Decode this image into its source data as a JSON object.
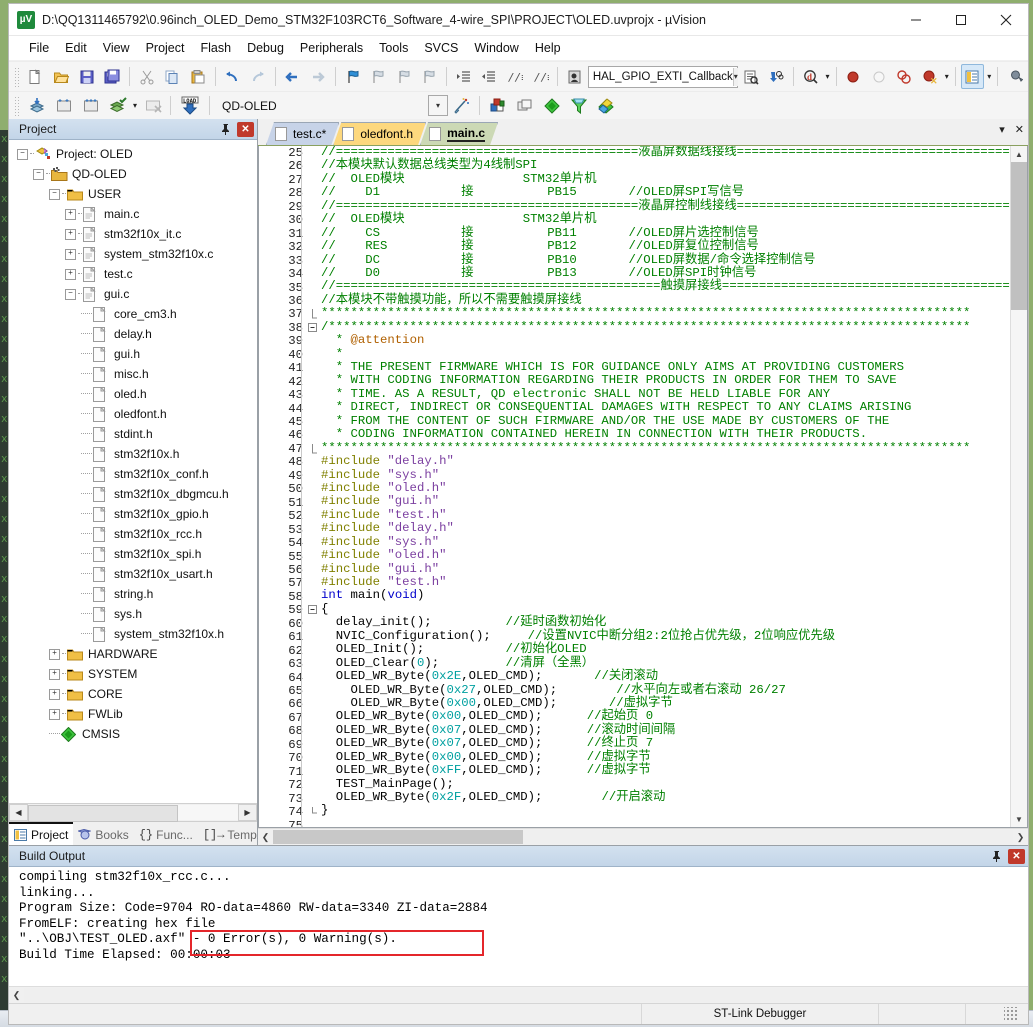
{
  "window": {
    "title": "D:\\QQ1311465792\\0.96inch_OLED_Demo_STM32F103RCT6_Software_4-wire_SPI\\PROJECT\\OLED.uvprojx - µVision",
    "app_icon": "uvision-icon",
    "minimize": "—",
    "maximize": "▢",
    "close": "✕"
  },
  "menubar": {
    "items": [
      "File",
      "Edit",
      "View",
      "Project",
      "Flash",
      "Debug",
      "Peripherals",
      "Tools",
      "SVCS",
      "Window",
      "Help"
    ]
  },
  "toolbar1": {
    "function_combo_value": "HAL_GPIO_EXTI_Callback"
  },
  "toolbar2": {
    "target_combo_value": "QD-OLED",
    "load_label": "LOAD"
  },
  "project_panel": {
    "title": "Project",
    "pin": "📌",
    "close": "✕",
    "tree": [
      {
        "label": "Project: OLED",
        "depth": 0,
        "expander": "minus",
        "icon": "project-icon"
      },
      {
        "label": "QD-OLED",
        "depth": 1,
        "expander": "minus",
        "icon": "target-icon"
      },
      {
        "label": "USER",
        "depth": 2,
        "expander": "minus",
        "icon": "folder-icon"
      },
      {
        "label": "main.c",
        "depth": 3,
        "expander": "plus",
        "icon": "c-file-icon"
      },
      {
        "label": "stm32f10x_it.c",
        "depth": 3,
        "expander": "plus",
        "icon": "c-file-icon"
      },
      {
        "label": "system_stm32f10x.c",
        "depth": 3,
        "expander": "plus",
        "icon": "c-file-icon"
      },
      {
        "label": "test.c",
        "depth": 3,
        "expander": "plus",
        "icon": "c-file-icon"
      },
      {
        "label": "gui.c",
        "depth": 3,
        "expander": "minus",
        "icon": "c-file-icon"
      },
      {
        "label": "core_cm3.h",
        "depth": 4,
        "expander": "none",
        "icon": "h-file-icon"
      },
      {
        "label": "delay.h",
        "depth": 4,
        "expander": "none",
        "icon": "h-file-icon"
      },
      {
        "label": "gui.h",
        "depth": 4,
        "expander": "none",
        "icon": "h-file-icon"
      },
      {
        "label": "misc.h",
        "depth": 4,
        "expander": "none",
        "icon": "h-file-icon"
      },
      {
        "label": "oled.h",
        "depth": 4,
        "expander": "none",
        "icon": "h-file-icon"
      },
      {
        "label": "oledfont.h",
        "depth": 4,
        "expander": "none",
        "icon": "h-file-icon"
      },
      {
        "label": "stdint.h",
        "depth": 4,
        "expander": "none",
        "icon": "h-file-icon"
      },
      {
        "label": "stm32f10x.h",
        "depth": 4,
        "expander": "none",
        "icon": "h-file-icon"
      },
      {
        "label": "stm32f10x_conf.h",
        "depth": 4,
        "expander": "none",
        "icon": "h-file-icon"
      },
      {
        "label": "stm32f10x_dbgmcu.h",
        "depth": 4,
        "expander": "none",
        "icon": "h-file-icon"
      },
      {
        "label": "stm32f10x_gpio.h",
        "depth": 4,
        "expander": "none",
        "icon": "h-file-icon"
      },
      {
        "label": "stm32f10x_rcc.h",
        "depth": 4,
        "expander": "none",
        "icon": "h-file-icon"
      },
      {
        "label": "stm32f10x_spi.h",
        "depth": 4,
        "expander": "none",
        "icon": "h-file-icon"
      },
      {
        "label": "stm32f10x_usart.h",
        "depth": 4,
        "expander": "none",
        "icon": "h-file-icon"
      },
      {
        "label": "string.h",
        "depth": 4,
        "expander": "none",
        "icon": "h-file-icon"
      },
      {
        "label": "sys.h",
        "depth": 4,
        "expander": "none",
        "icon": "h-file-icon"
      },
      {
        "label": "system_stm32f10x.h",
        "depth": 4,
        "expander": "none",
        "icon": "h-file-icon"
      },
      {
        "label": "HARDWARE",
        "depth": 2,
        "expander": "plus",
        "icon": "folder-icon"
      },
      {
        "label": "SYSTEM",
        "depth": 2,
        "expander": "plus",
        "icon": "folder-icon"
      },
      {
        "label": "CORE",
        "depth": 2,
        "expander": "plus",
        "icon": "folder-icon"
      },
      {
        "label": "FWLib",
        "depth": 2,
        "expander": "plus",
        "icon": "folder-icon"
      },
      {
        "label": "CMSIS",
        "depth": 2,
        "expander": "none",
        "icon": "cmsis-diamond-icon"
      }
    ],
    "bottom_tabs": [
      {
        "label": "Project",
        "selected": true,
        "icon": "project-tab-icon"
      },
      {
        "label": "Books",
        "selected": false,
        "icon": "books-icon"
      },
      {
        "label": "Func...",
        "selected": false,
        "icon": "functions-icon"
      },
      {
        "label": "Temp...",
        "selected": false,
        "icon": "templates-icon"
      }
    ]
  },
  "editor": {
    "tabs": [
      {
        "label": "test.c*",
        "style": "blue",
        "active": false
      },
      {
        "label": "oledfont.h",
        "style": "orange",
        "active": false
      },
      {
        "label": "main.c",
        "style": "green",
        "active": true
      }
    ],
    "tab_dropdown": "▾",
    "tab_close": "✕",
    "first_line_number": 25,
    "lines": [
      {
        "n": 25,
        "fold": "",
        "segs": [
          {
            "t": "//=========================================液晶屏数据线接线=========================================",
            "c": "cmt"
          }
        ]
      },
      {
        "n": 26,
        "fold": "",
        "segs": [
          {
            "t": "//本模块默认数据总线类型为4线制SPI",
            "c": "cmt"
          }
        ]
      },
      {
        "n": 27,
        "fold": "",
        "segs": [
          {
            "t": "//  OLED模块                STM32单片机",
            "c": "cmt"
          }
        ]
      },
      {
        "n": 28,
        "fold": "",
        "segs": [
          {
            "t": "//    D1           接          PB15       //OLED屏SPI写信号",
            "c": "cmt"
          }
        ]
      },
      {
        "n": 29,
        "fold": "",
        "segs": [
          {
            "t": "//=========================================液晶屏控制线接线=========================================",
            "c": "cmt"
          }
        ]
      },
      {
        "n": 30,
        "fold": "",
        "segs": [
          {
            "t": "//  OLED模块                STM32单片机",
            "c": "cmt"
          }
        ]
      },
      {
        "n": 31,
        "fold": "",
        "segs": [
          {
            "t": "//    CS           接          PB11       //OLED屏片选控制信号",
            "c": "cmt"
          }
        ]
      },
      {
        "n": 32,
        "fold": "",
        "segs": [
          {
            "t": "//    RES          接          PB12       //OLED屏复位控制信号",
            "c": "cmt"
          }
        ]
      },
      {
        "n": 33,
        "fold": "",
        "segs": [
          {
            "t": "//    DC           接          PB10       //OLED屏数据/命令选择控制信号",
            "c": "cmt"
          }
        ]
      },
      {
        "n": 34,
        "fold": "",
        "segs": [
          {
            "t": "//    D0           接          PB13       //OLED屏SPI时钟信号",
            "c": "cmt"
          }
        ]
      },
      {
        "n": 35,
        "fold": "",
        "segs": [
          {
            "t": "//============================================触摸屏接线============================================//",
            "c": "cmt"
          }
        ]
      },
      {
        "n": 36,
        "fold": "",
        "segs": [
          {
            "t": "//本模块不带触摸功能，所以不需要触摸屏接线",
            "c": "cmt"
          }
        ]
      },
      {
        "n": 37,
        "fold": "end",
        "segs": [
          {
            "t": "****************************************************************************************",
            "c": "cmt"
          }
        ]
      },
      {
        "n": 38,
        "fold": "start",
        "segs": [
          {
            "t": "/***************************************************************************************",
            "c": "cmt"
          }
        ]
      },
      {
        "n": 39,
        "fold": "",
        "segs": [
          {
            "t": "  * ",
            "c": "cmt"
          },
          {
            "t": "@attention",
            "c": "attn"
          }
        ]
      },
      {
        "n": 40,
        "fold": "",
        "segs": [
          {
            "t": "  *",
            "c": "cmt"
          }
        ]
      },
      {
        "n": 41,
        "fold": "",
        "segs": [
          {
            "t": "  * THE PRESENT FIRMWARE WHICH IS FOR GUIDANCE ONLY AIMS AT PROVIDING CUSTOMERS",
            "c": "cmt"
          }
        ]
      },
      {
        "n": 42,
        "fold": "",
        "segs": [
          {
            "t": "  * WITH CODING INFORMATION REGARDING THEIR PRODUCTS IN ORDER FOR THEM TO SAVE",
            "c": "cmt"
          }
        ]
      },
      {
        "n": 43,
        "fold": "",
        "segs": [
          {
            "t": "  * TIME. AS A RESULT, QD electronic SHALL NOT BE HELD LIABLE FOR ANY",
            "c": "cmt"
          }
        ]
      },
      {
        "n": 44,
        "fold": "",
        "segs": [
          {
            "t": "  * DIRECT, INDIRECT OR CONSEQUENTIAL DAMAGES WITH RESPECT TO ANY CLAIMS ARISING",
            "c": "cmt"
          }
        ]
      },
      {
        "n": 45,
        "fold": "",
        "segs": [
          {
            "t": "  * FROM THE CONTENT OF SUCH FIRMWARE AND/OR THE USE MADE BY CUSTOMERS OF THE",
            "c": "cmt"
          }
        ]
      },
      {
        "n": 46,
        "fold": "",
        "segs": [
          {
            "t": "  * CODING INFORMATION CONTAINED HEREIN IN CONNECTION WITH THEIR PRODUCTS.",
            "c": "cmt"
          }
        ]
      },
      {
        "n": 47,
        "fold": "end",
        "segs": [
          {
            "t": "****************************************************************************************",
            "c": "cmt"
          }
        ]
      },
      {
        "n": 48,
        "fold": "",
        "segs": [
          {
            "t": "#include ",
            "c": "pre"
          },
          {
            "t": "\"delay.h\"",
            "c": "str"
          }
        ]
      },
      {
        "n": 49,
        "fold": "",
        "segs": [
          {
            "t": "#include ",
            "c": "pre"
          },
          {
            "t": "\"sys.h\"",
            "c": "str"
          }
        ]
      },
      {
        "n": 50,
        "fold": "",
        "segs": [
          {
            "t": "#include ",
            "c": "pre"
          },
          {
            "t": "\"oled.h\"",
            "c": "str"
          }
        ]
      },
      {
        "n": 51,
        "fold": "",
        "segs": [
          {
            "t": "#include ",
            "c": "pre"
          },
          {
            "t": "\"gui.h\"",
            "c": "str"
          }
        ]
      },
      {
        "n": 52,
        "fold": "",
        "segs": [
          {
            "t": "#include ",
            "c": "pre"
          },
          {
            "t": "\"test.h\"",
            "c": "str"
          }
        ]
      },
      {
        "n": 53,
        "fold": "",
        "segs": [
          {
            "t": "#include ",
            "c": "pre"
          },
          {
            "t": "\"delay.h\"",
            "c": "str"
          }
        ]
      },
      {
        "n": 54,
        "fold": "",
        "segs": [
          {
            "t": "#include ",
            "c": "pre"
          },
          {
            "t": "\"sys.h\"",
            "c": "str"
          }
        ]
      },
      {
        "n": 55,
        "fold": "",
        "segs": [
          {
            "t": "#include ",
            "c": "pre"
          },
          {
            "t": "\"oled.h\"",
            "c": "str"
          }
        ]
      },
      {
        "n": 56,
        "fold": "",
        "segs": [
          {
            "t": "#include ",
            "c": "pre"
          },
          {
            "t": "\"gui.h\"",
            "c": "str"
          }
        ]
      },
      {
        "n": 57,
        "fold": "",
        "segs": [
          {
            "t": "#include ",
            "c": "pre"
          },
          {
            "t": "\"test.h\"",
            "c": "str"
          }
        ]
      },
      {
        "n": 58,
        "fold": "",
        "segs": [
          {
            "t": "int ",
            "c": "kw"
          },
          {
            "t": "main(",
            "c": "plain"
          },
          {
            "t": "void",
            "c": "kw"
          },
          {
            "t": ")",
            "c": "plain"
          }
        ]
      },
      {
        "n": 59,
        "fold": "start",
        "segs": [
          {
            "t": "{",
            "c": "plain"
          }
        ]
      },
      {
        "n": 60,
        "fold": "",
        "segs": [
          {
            "t": "  delay_init();          ",
            "c": "plain"
          },
          {
            "t": "//延时函数初始化",
            "c": "cmt"
          }
        ]
      },
      {
        "n": 61,
        "fold": "",
        "segs": [
          {
            "t": "  NVIC_Configuration();     ",
            "c": "plain"
          },
          {
            "t": "//设置NVIC中断分组2:2位抢占优先级，2位响应优先级",
            "c": "cmt"
          }
        ]
      },
      {
        "n": 62,
        "fold": "",
        "segs": [
          {
            "t": "  OLED_Init();           ",
            "c": "plain"
          },
          {
            "t": "//初始化OLED",
            "c": "cmt"
          }
        ]
      },
      {
        "n": 63,
        "fold": "",
        "segs": [
          {
            "t": "  OLED_Clear(",
            "c": "plain"
          },
          {
            "t": "0",
            "c": "num"
          },
          {
            "t": ");         ",
            "c": "plain"
          },
          {
            "t": "//清屏（全黑）",
            "c": "cmt"
          }
        ]
      },
      {
        "n": 64,
        "fold": "",
        "segs": [
          {
            "t": "  OLED_WR_Byte(",
            "c": "plain"
          },
          {
            "t": "0x2E",
            "c": "num"
          },
          {
            "t": ",OLED_CMD);       ",
            "c": "plain"
          },
          {
            "t": "//关闭滚动",
            "c": "cmt"
          }
        ]
      },
      {
        "n": 65,
        "fold": "",
        "segs": [
          {
            "t": "    OLED_WR_Byte(",
            "c": "plain"
          },
          {
            "t": "0x27",
            "c": "num"
          },
          {
            "t": ",OLED_CMD);        ",
            "c": "plain"
          },
          {
            "t": "//水平向左或者右滚动 26/27",
            "c": "cmt"
          }
        ]
      },
      {
        "n": 66,
        "fold": "",
        "segs": [
          {
            "t": "    OLED_WR_Byte(",
            "c": "plain"
          },
          {
            "t": "0x00",
            "c": "num"
          },
          {
            "t": ",OLED_CMD);       ",
            "c": "plain"
          },
          {
            "t": "//虚拟字节",
            "c": "cmt"
          }
        ]
      },
      {
        "n": 67,
        "fold": "",
        "segs": [
          {
            "t": "  OLED_WR_Byte(",
            "c": "plain"
          },
          {
            "t": "0x00",
            "c": "num"
          },
          {
            "t": ",OLED_CMD);      ",
            "c": "plain"
          },
          {
            "t": "//起始页 0",
            "c": "cmt"
          }
        ]
      },
      {
        "n": 68,
        "fold": "",
        "segs": [
          {
            "t": "  OLED_WR_Byte(",
            "c": "plain"
          },
          {
            "t": "0x07",
            "c": "num"
          },
          {
            "t": ",OLED_CMD);      ",
            "c": "plain"
          },
          {
            "t": "//滚动时间间隔",
            "c": "cmt"
          }
        ]
      },
      {
        "n": 69,
        "fold": "",
        "segs": [
          {
            "t": "  OLED_WR_Byte(",
            "c": "plain"
          },
          {
            "t": "0x07",
            "c": "num"
          },
          {
            "t": ",OLED_CMD);      ",
            "c": "plain"
          },
          {
            "t": "//终止页 7",
            "c": "cmt"
          }
        ]
      },
      {
        "n": 70,
        "fold": "",
        "segs": [
          {
            "t": "  OLED_WR_Byte(",
            "c": "plain"
          },
          {
            "t": "0x00",
            "c": "num"
          },
          {
            "t": ",OLED_CMD);      ",
            "c": "plain"
          },
          {
            "t": "//虚拟字节",
            "c": "cmt"
          }
        ]
      },
      {
        "n": 71,
        "fold": "",
        "segs": [
          {
            "t": "  OLED_WR_Byte(",
            "c": "plain"
          },
          {
            "t": "0xFF",
            "c": "num"
          },
          {
            "t": ",OLED_CMD);      ",
            "c": "plain"
          },
          {
            "t": "//虚拟字节",
            "c": "cmt"
          }
        ]
      },
      {
        "n": 72,
        "fold": "",
        "segs": [
          {
            "t": "  TEST_MainPage();",
            "c": "plain"
          }
        ]
      },
      {
        "n": 73,
        "fold": "",
        "segs": [
          {
            "t": "  OLED_WR_Byte(",
            "c": "plain"
          },
          {
            "t": "0x2F",
            "c": "num"
          },
          {
            "t": ",OLED_CMD);        ",
            "c": "plain"
          },
          {
            "t": "//开启滚动",
            "c": "cmt"
          }
        ]
      },
      {
        "n": 74,
        "fold": "endbrace",
        "segs": [
          {
            "t": "}",
            "c": "plain"
          }
        ]
      },
      {
        "n": 75,
        "fold": "",
        "segs": [
          {
            "t": "",
            "c": "plain"
          }
        ]
      },
      {
        "n": 76,
        "fold": "",
        "segs": [
          {
            "t": "",
            "c": "plain"
          }
        ]
      },
      {
        "n": 77,
        "fold": "",
        "segs": [
          {
            "t": "",
            "c": "plain"
          }
        ]
      }
    ]
  },
  "build_output": {
    "title": "Build Output",
    "pin": "📌",
    "close": "✕",
    "lines": [
      "compiling stm32f10x_rcc.c...",
      "linking...",
      "Program Size: Code=9704 RO-data=4860 RW-data=3340 ZI-data=2884",
      "FromELF: creating hex file",
      "\"..\\OBJ\\TEST_OLED.axf\" - 0 Error(s), 0 Warning(s).",
      "Build Time Elapsed:  00:00:03"
    ],
    "highlight_color": "#e4262b",
    "highlight_text": "- 0 Error(s), 0 Warning(s)."
  },
  "statusbar": {
    "left": "",
    "debugger": "ST-Link Debugger"
  }
}
